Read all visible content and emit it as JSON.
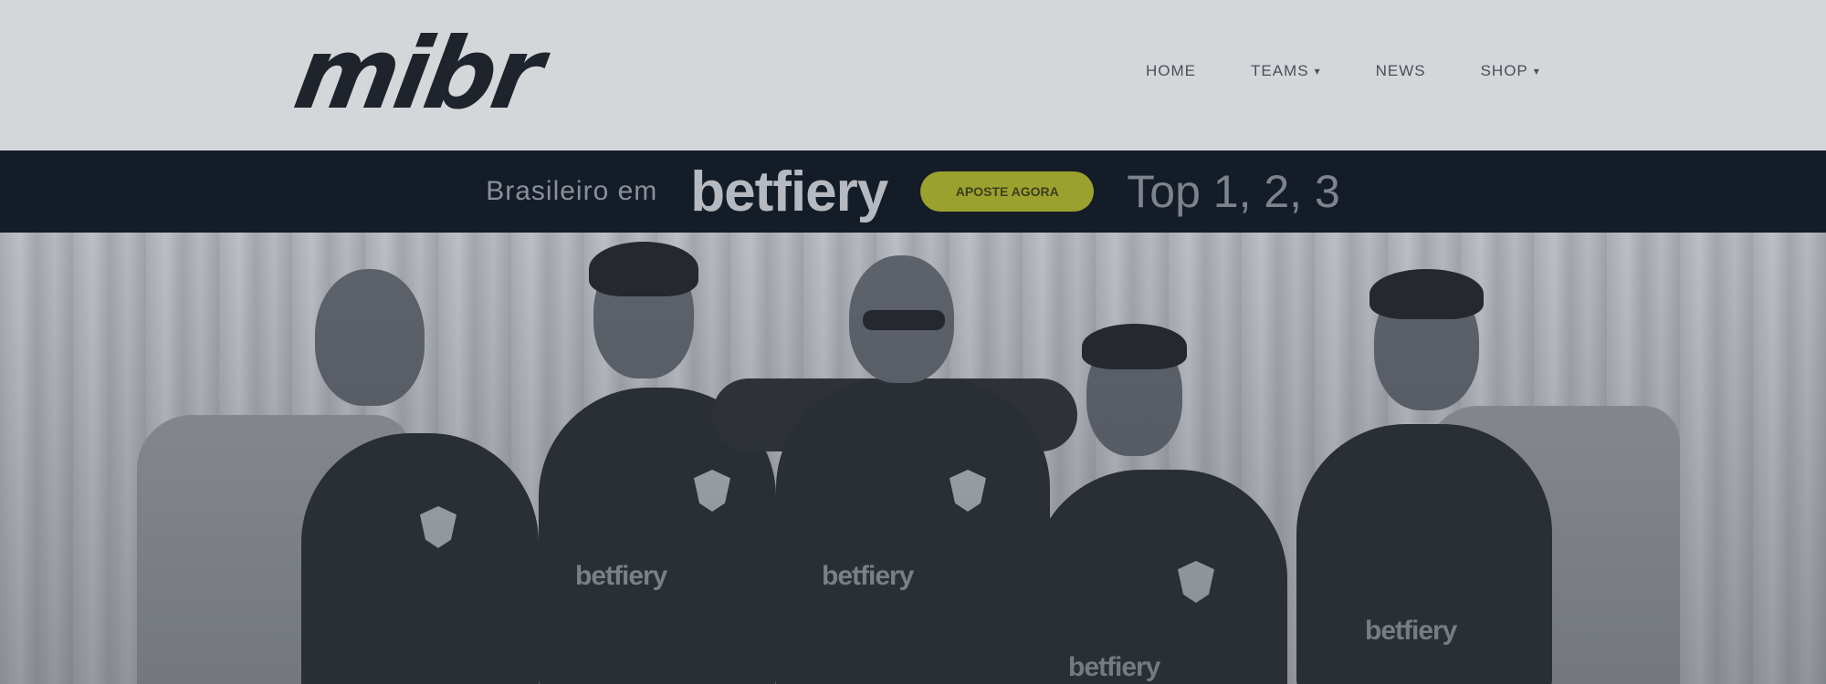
{
  "header": {
    "logo_text": "mibr",
    "nav": [
      {
        "label": "HOME",
        "has_dropdown": false
      },
      {
        "label": "TEAMS",
        "has_dropdown": true
      },
      {
        "label": "NEWS",
        "has_dropdown": false
      },
      {
        "label": "SHOP",
        "has_dropdown": true
      }
    ]
  },
  "sponsor_bar": {
    "prefix": "Brasileiro em",
    "brand": "betfiery",
    "cta": "APOSTE AGORA",
    "odds": "Top 1, 2, 3"
  },
  "hero": {
    "shirt_sponsor": "betfiery"
  },
  "colors": {
    "header_bg": "#d4d7da",
    "sponsor_bar_bg": "#141c27",
    "cta_accent": "#9aa12d"
  }
}
